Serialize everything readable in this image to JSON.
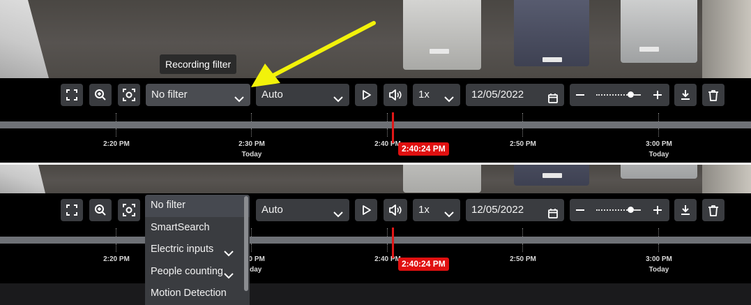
{
  "tooltip": "Recording filter",
  "top": {
    "filter_value": "No filter",
    "quality_value": "Auto",
    "speed_value": "1x",
    "date_value": "12/05/2022",
    "cursor_time": "2:40:24 PM"
  },
  "bottom": {
    "quality_value": "Auto",
    "speed_value": "1x",
    "date_value": "12/05/2022",
    "cursor_time": "2:40:24 PM"
  },
  "timeline": {
    "ticks": [
      {
        "label": "2:20 PM",
        "sub": ""
      },
      {
        "label": "2:30 PM",
        "sub": "Today"
      },
      {
        "label": "2:40 PM",
        "sub": ""
      },
      {
        "label": "2:50 PM",
        "sub": ""
      },
      {
        "label": "3:00 PM",
        "sub": "Today"
      }
    ]
  },
  "dropdown": {
    "items": [
      {
        "label": "No filter",
        "expandable": false
      },
      {
        "label": "SmartSearch",
        "expandable": false
      },
      {
        "label": "Electric inputs",
        "expandable": true
      },
      {
        "label": "People counting",
        "expandable": true
      },
      {
        "label": "Motion Detection",
        "expandable": false
      }
    ]
  },
  "colors": {
    "cursor": "#e01010",
    "arrow": "#f2f20a",
    "button_bg": "#3a3c40",
    "track": "#6e7176"
  },
  "icons": [
    "fullscreen-icon",
    "zoom-in-icon",
    "screenshot-icon",
    "chevron-down-icon",
    "play-icon",
    "volume-icon",
    "calendar-icon",
    "minus-icon",
    "plus-icon",
    "download-icon",
    "trash-icon"
  ]
}
